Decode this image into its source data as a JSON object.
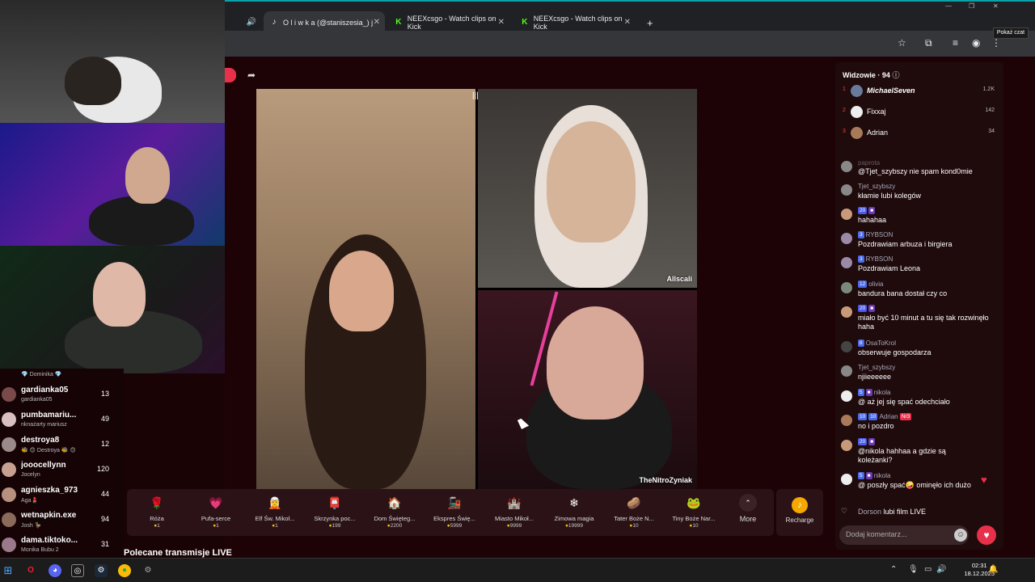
{
  "browser": {
    "tabs": [
      {
        "label": "O l i w k a (@staniszesia_) j",
        "icon": "tiktok-icon",
        "active": true
      },
      {
        "label": "NEEXcsgo - Watch clips on Kick",
        "icon": "kick-icon",
        "active": false
      },
      {
        "label": "NEEXcsgo - Watch clips on Kick",
        "icon": "kick-icon",
        "active": false
      }
    ],
    "new_tab": "+",
    "tooltip": "Pokaż czat"
  },
  "live": {
    "streamers": [
      "Allscali",
      "TheNitroZyniak"
    ],
    "gifts": [
      {
        "name": "Róża",
        "price": "1",
        "icon": "🌹"
      },
      {
        "name": "Pufa-serce",
        "price": "1",
        "icon": "💗"
      },
      {
        "name": "Elf Św. Mikoł...",
        "price": "1",
        "icon": "🧝"
      },
      {
        "name": "Skrzynka poc...",
        "price": "199",
        "icon": "📮"
      },
      {
        "name": "Dom Święteg...",
        "price": "2200",
        "icon": "🏠"
      },
      {
        "name": "Ekspres Świę...",
        "price": "5999",
        "icon": "🚂"
      },
      {
        "name": "Miasto Mikoł...",
        "price": "9999",
        "icon": "🏰"
      },
      {
        "name": "Zimowa magia",
        "price": "19999",
        "icon": "❄"
      },
      {
        "name": "Tater Boże N...",
        "price": "10",
        "icon": "🥔"
      },
      {
        "name": "Tiny Boże Nar...",
        "price": "10",
        "icon": "🐸"
      }
    ],
    "more_label": "More",
    "recharge_label": "Recharge",
    "recommended_label": "Polecane transmisje LIVE"
  },
  "viewers": {
    "title": "Widzowie",
    "count": "94",
    "top": [
      {
        "rank": "1",
        "name": "MichaelSeven",
        "score": "1.2K"
      },
      {
        "rank": "2",
        "name": "Fixxaj",
        "score": "142"
      },
      {
        "rank": "3",
        "name": "Adrian",
        "score": "34"
      }
    ]
  },
  "chat": {
    "messages": [
      {
        "user": "paprota",
        "badges": [],
        "text": "@Tjet_szybszy nie spam kond0mie"
      },
      {
        "user": "Tjet_szybszy",
        "badges": [],
        "text": "kłamie lubi kolegów"
      },
      {
        "user": "",
        "badges": [
          "20"
        ],
        "text": "hahahaa"
      },
      {
        "user": "RYBSON",
        "badges": [
          "3"
        ],
        "text": "Pozdrawiam arbuza i birgiera"
      },
      {
        "user": "RYBSON",
        "badges": [
          "3"
        ],
        "text": "Pozdrawiam Leona"
      },
      {
        "user": "olivia",
        "badges": [
          "12"
        ],
        "text": "bandura bana dostał czy co"
      },
      {
        "user": "",
        "badges": [
          "20"
        ],
        "text": "miało być 10 minut a tu się tak rozwinęło haha"
      },
      {
        "user": "OsaToKrol",
        "badges": [
          "8"
        ],
        "text": "obserwuje gospodarza"
      },
      {
        "user": "Tjet_szybszy",
        "badges": [],
        "text": "njiieeeeee"
      },
      {
        "user": "nikola",
        "badges": [
          "5"
        ],
        "text": "@ aż jej się spać odechciało"
      },
      {
        "user": "Adrian",
        "badges": [
          "10",
          "10"
        ],
        "extra_badge": "Nr3",
        "text": "no i pozdro"
      },
      {
        "user": "",
        "badges": [
          "20"
        ],
        "text": "@nikola hahhaa a gdzie są koleżanki?"
      },
      {
        "user": "nikola",
        "badges": [
          "5"
        ],
        "text": "@ poszły spać🤪 ominęło ich dużo"
      },
      {
        "user": "Dorson",
        "badges": [],
        "text": "lubi film LIVE"
      }
    ],
    "input_placeholder": "Dodaj komentarz..."
  },
  "leaderboard": [
    {
      "name": "",
      "sub": "💎 Dominika 💎",
      "score": ""
    },
    {
      "name": "gardianka05",
      "sub": "gardianka05",
      "score": "13"
    },
    {
      "name": "pumbamariu...",
      "sub": "nknażarty mariusz",
      "score": "49"
    },
    {
      "name": "destroya8",
      "sub": "🐝 😊 Destroya 🐝 😊",
      "score": "12"
    },
    {
      "name": "jooocellynn",
      "sub": "Jocelyn",
      "score": "120"
    },
    {
      "name": "agnieszka_973",
      "sub": "Aga💄",
      "score": "44"
    },
    {
      "name": "wetnapkin.exe",
      "sub": "Josh 🦆",
      "score": "94"
    },
    {
      "name": "dama.tiktoko...",
      "sub": "Monika Bubu 2",
      "score": "31"
    }
  ],
  "taskbar": {
    "time": "02:31",
    "date": "18.12.2025"
  }
}
